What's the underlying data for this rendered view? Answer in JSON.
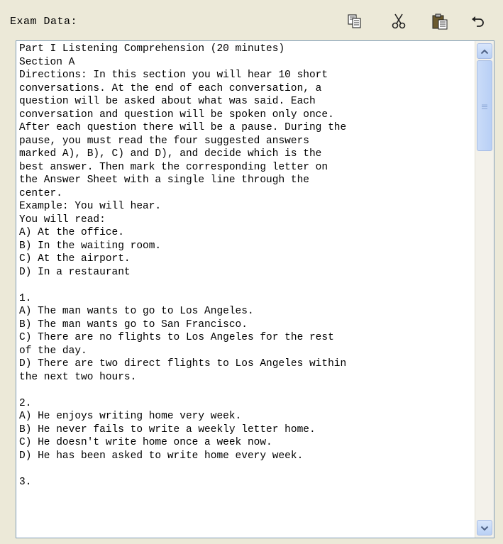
{
  "header": {
    "label": "Exam Data:",
    "tools": [
      {
        "name": "copy",
        "icon": "copy-icon"
      },
      {
        "name": "cut",
        "icon": "scissors-icon"
      },
      {
        "name": "paste",
        "icon": "paste-icon"
      },
      {
        "name": "undo",
        "icon": "undo-arrow-icon"
      }
    ]
  },
  "editor": {
    "text": "Part I Listening Comprehension (20 minutes)\nSection A\nDirections: In this section you will hear 10 short\nconversations. At the end of each conversation, a\nquestion will be asked about what was said. Each\nconversation and question will be spoken only once.\nAfter each question there will be a pause. During the\npause, you must read the four suggested answers\nmarked A), B), C) and D), and decide which is the\nbest answer. Then mark the corresponding letter on\nthe Answer Sheet with a single line through the\ncenter.\nExample: You will hear.\nYou will read:\nA) At the office.\nB) In the waiting room.\nC) At the airport.\nD) In a restaurant\n\n1.\nA) The man wants to go to Los Angeles.\nB) The man wants go to San Francisco.\nC) There are no flights to Los Angeles for the rest\nof the day.\nD) There are two direct flights to Los Angeles within\nthe next two hours.\n\n2.\nA) He enjoys writing home very week.\nB) He never fails to write a weekly letter home.\nC) He doesn't write home once a week now.\nD) He has been asked to write home every week.\n\n3."
  },
  "colors": {
    "window_bg": "#ECE9D8",
    "editor_border": "#7F9DB9",
    "scrollbar_accent": "#B9D0F5"
  }
}
